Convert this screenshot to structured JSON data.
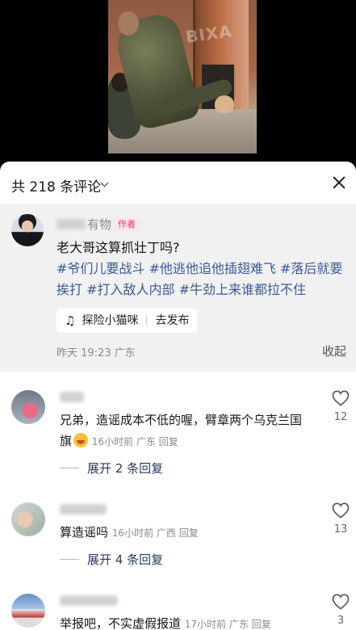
{
  "header": {
    "count_label": "共 218 条评论"
  },
  "pinned": {
    "name_visible": "有物",
    "tag": "作者",
    "text": "老大哥这算抓壮丁吗?",
    "hashtags": "#爷们儿要战斗 #他逃他追他插翅难飞 #落后就要挨打 #打入敌人内部 #牛劲上来谁都拉不住",
    "music_title": "探险小猫咪",
    "music_action": "去发布",
    "time_location": "昨天 19:23 广东",
    "collapse_label": "收起"
  },
  "comments": [
    {
      "text": "兄弟，造谣成本不低的喔，臂章两个乌克兰国旗",
      "meta": "16小时前 广东 回复",
      "likes": "12",
      "expand_label": "展开 2 条回复"
    },
    {
      "text": "算造谣吗",
      "meta": "16小时前 广西 回复",
      "likes": "13",
      "expand_label": "展开 4 条回复"
    },
    {
      "text": "举报吧，不实虚假报道",
      "meta": "17小时前 广东 回复",
      "likes": "3"
    }
  ],
  "video": {
    "watermark": "BIXA"
  },
  "colors": {
    "accent_tag": "#e8365a",
    "hashtag": "#3a5a9a",
    "pinned_bg": "#f1f1f1"
  }
}
